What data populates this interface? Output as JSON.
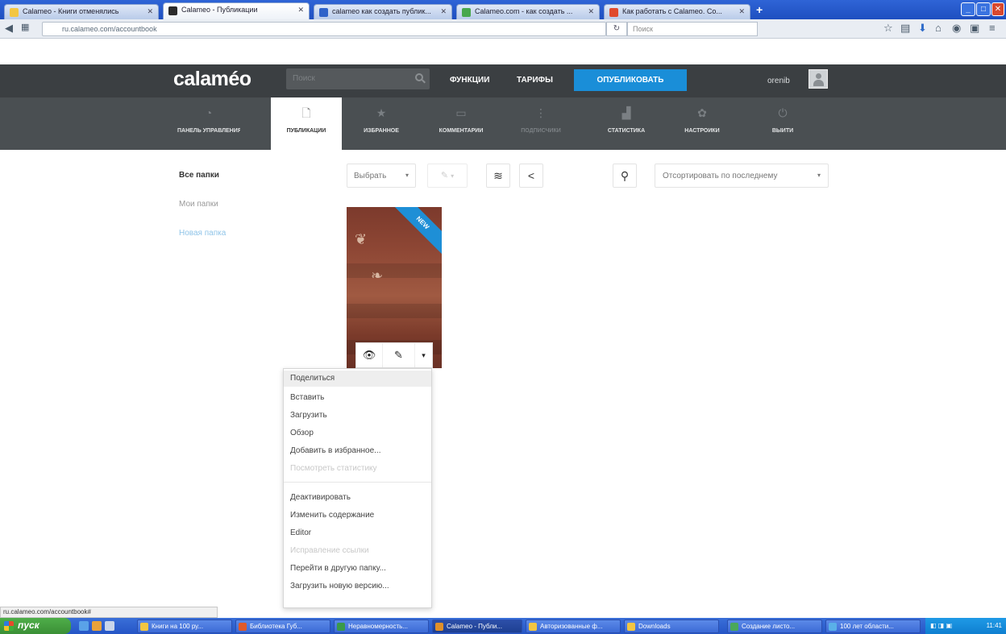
{
  "browser": {
    "tabs": [
      {
        "label": "Calameo - Книги отменялись"
      },
      {
        "label": "Calameo - Публикации"
      },
      {
        "label": "calameo как создать публик..."
      },
      {
        "label": "Calameo.com - как создать ..."
      },
      {
        "label": "Как работать с Calameo. Со..."
      }
    ],
    "url": "ru.calameo.com/accountbook",
    "search_placeholder": "Поиск"
  },
  "header": {
    "logo": "calaméo",
    "search_placeholder": "Поиск",
    "links": {
      "features": "ФУНКЦИИ",
      "tariffs": "ТАРИФЫ"
    },
    "publish": "ОПУБЛИКОВАТЬ",
    "username": "orenib"
  },
  "subnav": [
    {
      "label": "ПАНЕЛЬ УПРАВЛЕНИЯ"
    },
    {
      "label": "ПУБЛИКАЦИИ"
    },
    {
      "label": "ИЗБРАННОЕ"
    },
    {
      "label": "КОММЕНТАРИИ"
    },
    {
      "label": "ПОДПИСЧИКИ"
    },
    {
      "label": "СТАТИСТИКА"
    },
    {
      "label": "НАСТРОЙКИ"
    },
    {
      "label": "ВЫЙТИ"
    }
  ],
  "folders": {
    "all": "Все папки",
    "mine": "Мои папки",
    "new": "Новая папка"
  },
  "toolbar": {
    "select": "Выбрать",
    "sort": "Отсортировать по последнему"
  },
  "book": {
    "badge": "NEW"
  },
  "menu": {
    "group1": [
      "Поделиться",
      "Вставить",
      "Загрузить",
      "Обзор",
      "Добавить в избранное...",
      "Посмотреть статистику"
    ],
    "group2": [
      "Деактивировать",
      "Изменить содержание",
      "Editor",
      "Исправление ссылки",
      "Перейти в другую папку...",
      "Загрузить новую версию..."
    ]
  },
  "statusbar": {
    "url": "ru.calameo.com/accountbook#"
  },
  "taskbar": {
    "start": "пуск",
    "tasks": [
      {
        "label": "Книги на 100 ру..."
      },
      {
        "label": "Библиотека Губ..."
      },
      {
        "label": "Неравномерность..."
      },
      {
        "label": "Calameo - Публи..."
      },
      {
        "label": "Авторизованные ф..."
      },
      {
        "label": "Downloads"
      },
      {
        "label": "Создание листо..."
      },
      {
        "label": "100 лет области..."
      }
    ],
    "clock": "11:41"
  },
  "colors": {
    "topbar": "#3b3f42",
    "subnav": "#4a4f52",
    "accent": "#1a8ed8",
    "ribbon": "#1e8fd6"
  }
}
